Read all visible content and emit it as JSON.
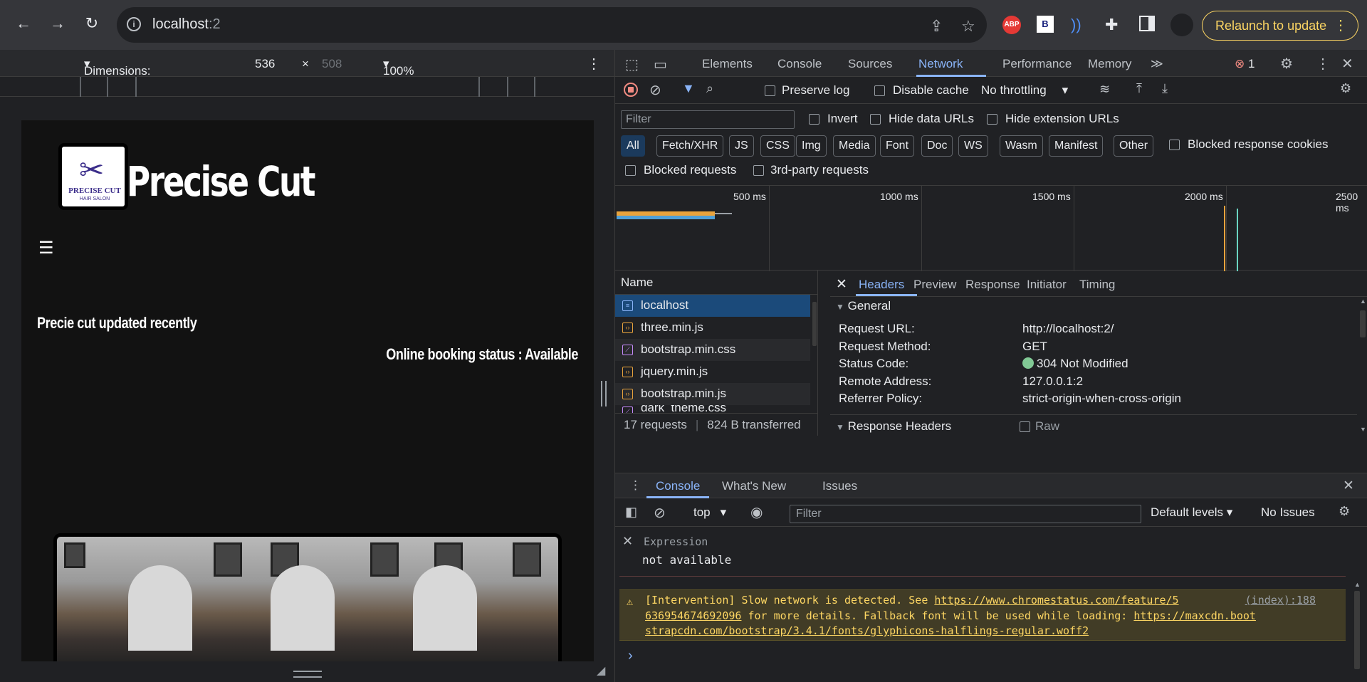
{
  "browser": {
    "url_host": "localhost",
    "url_port": ":2",
    "relaunch_label": "Relaunch to update",
    "extension_abp": "ABP",
    "extension_b": "B"
  },
  "device_toolbar": {
    "dimensions_label": "Dimensions: Responsive",
    "width": "536",
    "times": "×",
    "height": "508",
    "zoom": "100%"
  },
  "site": {
    "logo_text_1": "PRECISE CUT",
    "logo_text_2": "HAIR SALON",
    "title": "Precise Cut",
    "menu_icon": "☰",
    "updated_text": "Precie cut updated recently",
    "booking_text": "Online booking status : Available"
  },
  "devtools": {
    "tabs": [
      "Elements",
      "Console",
      "Sources",
      "Network",
      "Performance",
      "Memory"
    ],
    "active_tab": "Network",
    "error_count": "1",
    "preserve_log": "Preserve log",
    "disable_cache": "Disable cache",
    "throttling": "No throttling",
    "filter_placeholder": "Filter",
    "invert": "Invert",
    "hide_data_urls": "Hide data URLs",
    "hide_extension_urls": "Hide extension URLs",
    "type_filters": [
      "All",
      "Fetch/XHR",
      "JS",
      "CSS",
      "Img",
      "Media",
      "Font",
      "Doc",
      "WS",
      "Wasm",
      "Manifest",
      "Other"
    ],
    "blocked_response_cookies": "Blocked response cookies",
    "blocked_requests": "Blocked requests",
    "third_party": "3rd-party requests",
    "timeline_labels": [
      "500 ms",
      "1000 ms",
      "1500 ms",
      "2000 ms",
      "2500 ms"
    ],
    "name_header": "Name",
    "requests": [
      {
        "name": "localhost",
        "type": "doc"
      },
      {
        "name": "three.min.js",
        "type": "js"
      },
      {
        "name": "bootstrap.min.css",
        "type": "css"
      },
      {
        "name": "jquery.min.js",
        "type": "js"
      },
      {
        "name": "bootstrap.min.js",
        "type": "js"
      },
      {
        "name": "dark_theme.css",
        "type": "css"
      }
    ],
    "summary_requests": "17 requests",
    "summary_transferred": "824 B transferred",
    "detail_tabs": [
      "Headers",
      "Preview",
      "Response",
      "Initiator",
      "Timing"
    ],
    "general_label": "General",
    "general": [
      {
        "key": "Request URL:",
        "value": "http://localhost:2/"
      },
      {
        "key": "Request Method:",
        "value": "GET"
      },
      {
        "key": "Status Code:",
        "value": "304 Not Modified"
      },
      {
        "key": "Remote Address:",
        "value": "127.0.0.1:2"
      },
      {
        "key": "Referrer Policy:",
        "value": "strict-origin-when-cross-origin"
      }
    ],
    "response_headers_label": "Response Headers",
    "raw_label": "Raw"
  },
  "drawer": {
    "tabs": [
      "Console",
      "What's New",
      "Issues"
    ],
    "context": "top",
    "filter_placeholder": "Filter",
    "levels": "Default levels",
    "issues": "No Issues",
    "expression_label": "Expression",
    "expression_value": "not available",
    "warning_text_1": "[Intervention] Slow network is detected. See ",
    "warning_link_1": "https://www.chromestatus.com/feature/5",
    "warning_source": "(index):188",
    "warning_link_1b": "636954674692096",
    "warning_text_2": " for more details. Fallback font will be used while loading: ",
    "warning_link_2": "https://maxcdn.boot",
    "warning_link_2b": "strapcdn.com/bootstrap/3.4.1/fonts/glyphicons-halflings-regular.woff2",
    "prompt": "›"
  },
  "colors": {
    "accent": "#8ab4f8",
    "warning": "#fdd663",
    "status_ok": "#81c995",
    "error": "#f28b82"
  }
}
